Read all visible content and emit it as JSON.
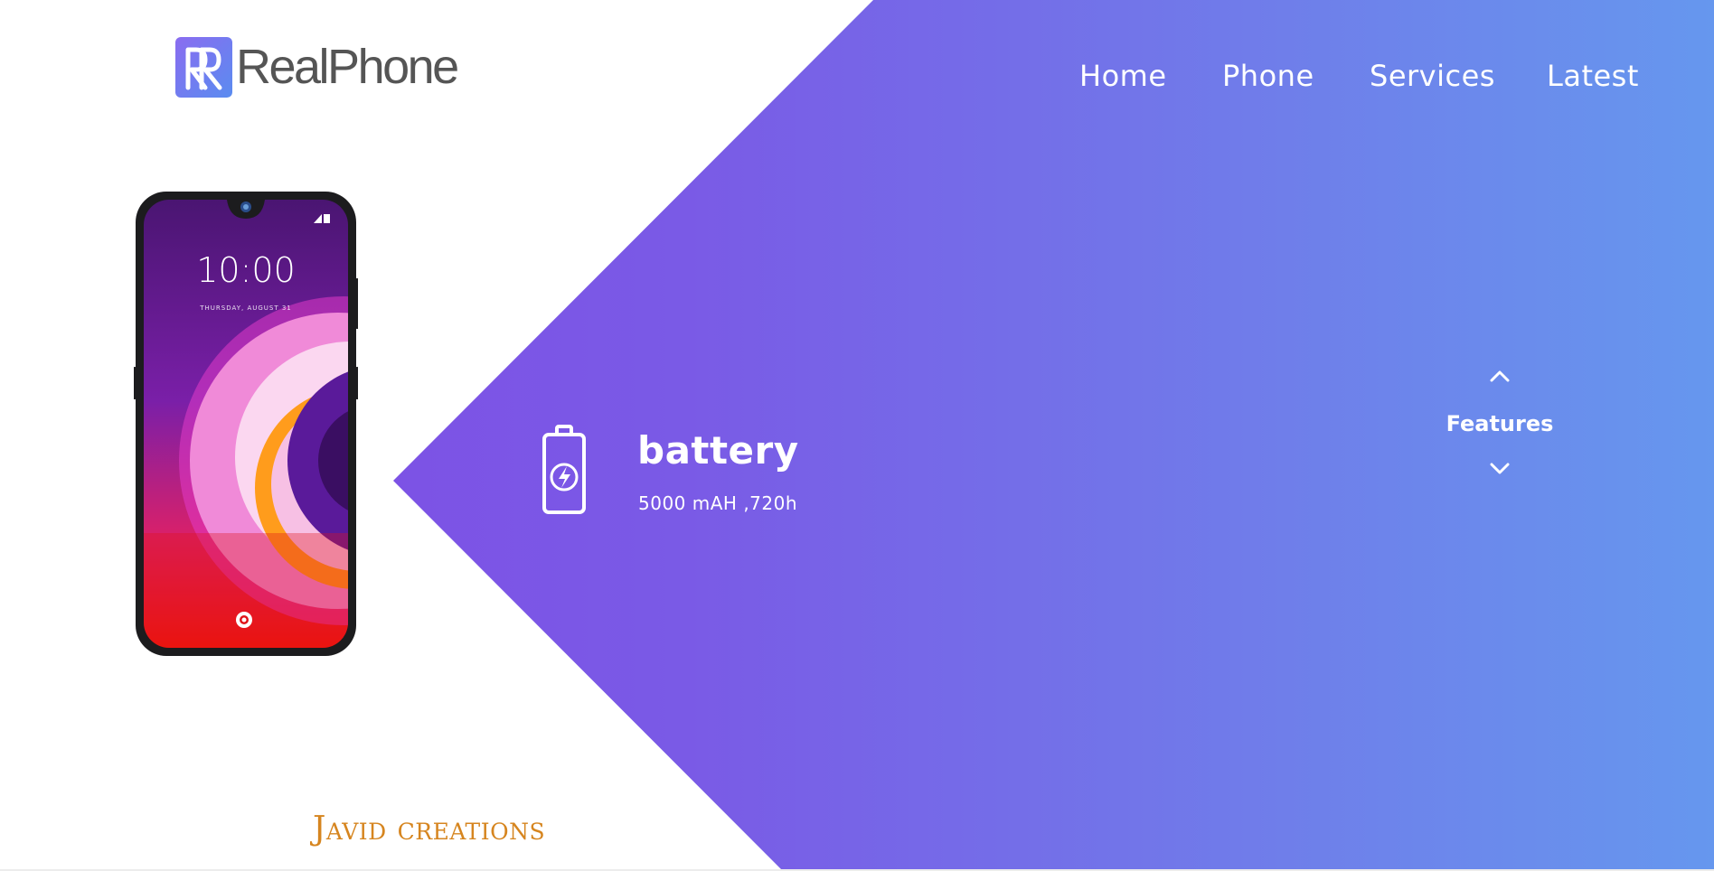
{
  "brand": {
    "logo_text": "RealPhone",
    "colors": {
      "gradient_start": "#8048e4",
      "gradient_end": "#6697ee"
    }
  },
  "nav": {
    "items": [
      "Home",
      "Phone",
      "Services",
      "Latest"
    ]
  },
  "phone_screen": {
    "time": "10:00",
    "date": "THURSDAY, AUGUST 31"
  },
  "feature": {
    "icon": "battery-icon",
    "title": "battery",
    "value": "5000 mAH ,720h"
  },
  "features_nav": {
    "label": "Features",
    "up_icon": "chevron-up-icon",
    "down_icon": "chevron-down-icon"
  },
  "footer": {
    "credit": "Javid creations",
    "color": "#d6851f"
  }
}
